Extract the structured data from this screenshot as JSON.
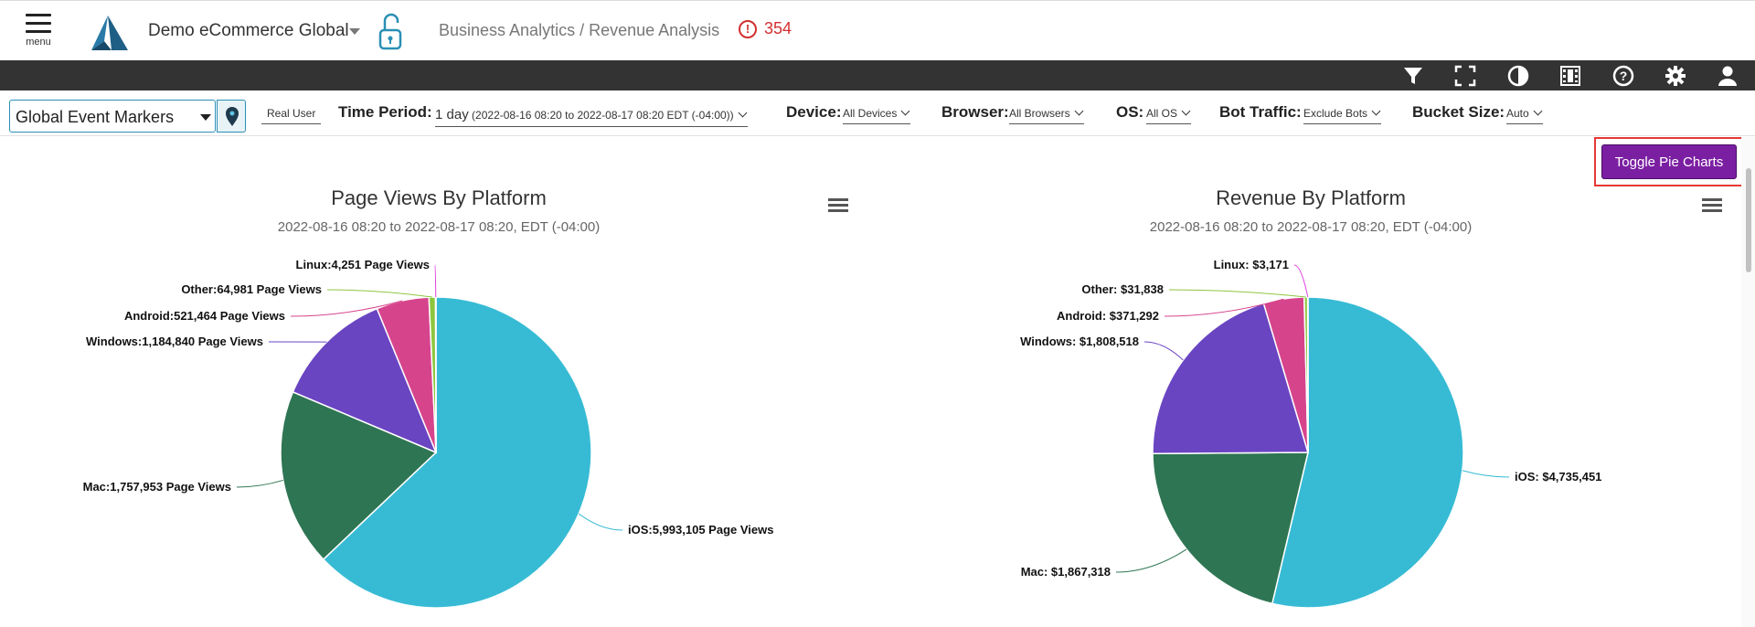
{
  "header": {
    "menu_label": "menu",
    "app_name": "Demo eCommerce Global",
    "breadcrumb": "Business Analytics / Revenue Analysis",
    "alert_count": "354",
    "alert_color": "#d32f2f"
  },
  "toolbar": {
    "icons": [
      "filter-icon",
      "fullscreen-icon",
      "contrast-icon",
      "film-icon",
      "help-icon",
      "gear-icon",
      "user-icon"
    ]
  },
  "filters": {
    "event_markers": "Global Event Markers",
    "real_user": "Real User",
    "time_period_label": "Time Period:",
    "time_period_value": "1 day",
    "time_period_range": "(2022-08-16 08:20 to 2022-08-17 08:20 EDT (-04:00))",
    "device_label": "Device:",
    "device_value": "All Devices",
    "browser_label": "Browser:",
    "browser_value": "All Browsers",
    "os_label": "OS:",
    "os_value": "All OS",
    "bot_label": "Bot Traffic:",
    "bot_value": "Exclude Bots",
    "bucket_label": "Bucket Size:",
    "bucket_value": "Auto"
  },
  "toggle_label": "Toggle Pie Charts",
  "toggle_color": "#7b1fa2",
  "chart_data": [
    {
      "type": "pie",
      "title": "Page Views By Platform",
      "subtitle": "2022-08-16 08:20 to 2022-08-17 08:20, EDT (-04:00)",
      "slices": [
        {
          "name": "iOS",
          "value": 5993105,
          "label": "iOS:5,993,105 Page Views",
          "color": "#37bbd5"
        },
        {
          "name": "Mac",
          "value": 1757953,
          "label": "Mac:1,757,953 Page Views",
          "color": "#2e7553"
        },
        {
          "name": "Windows",
          "value": 1184840,
          "label": "Windows:1,184,840 Page Views",
          "color": "#6a45c2"
        },
        {
          "name": "Android",
          "value": 521464,
          "label": "Android:521,464 Page Views",
          "color": "#d6448c"
        },
        {
          "name": "Other",
          "value": 64981,
          "label": "Other:64,981 Page Views",
          "color": "#8dc63f"
        },
        {
          "name": "Linux",
          "value": 4251,
          "label": "Linux:4,251 Page Views",
          "color": "#e040e0"
        }
      ]
    },
    {
      "type": "pie",
      "title": "Revenue By Platform",
      "subtitle": "2022-08-16 08:20 to 2022-08-17 08:20, EDT (-04:00)",
      "slices": [
        {
          "name": "iOS",
          "value": 4735451,
          "label": "iOS: $4,735,451",
          "color": "#37bbd5"
        },
        {
          "name": "Mac",
          "value": 1867318,
          "label": "Mac: $1,867,318",
          "color": "#2e7553"
        },
        {
          "name": "Windows",
          "value": 1808518,
          "label": "Windows: $1,808,518",
          "color": "#6a45c2"
        },
        {
          "name": "Android",
          "value": 371292,
          "label": "Android: $371,292",
          "color": "#d6448c"
        },
        {
          "name": "Other",
          "value": 31838,
          "label": "Other: $31,838",
          "color": "#8dc63f"
        },
        {
          "name": "Linux",
          "value": 3171,
          "label": "Linux: $3,171",
          "color": "#e040e0"
        }
      ]
    }
  ]
}
